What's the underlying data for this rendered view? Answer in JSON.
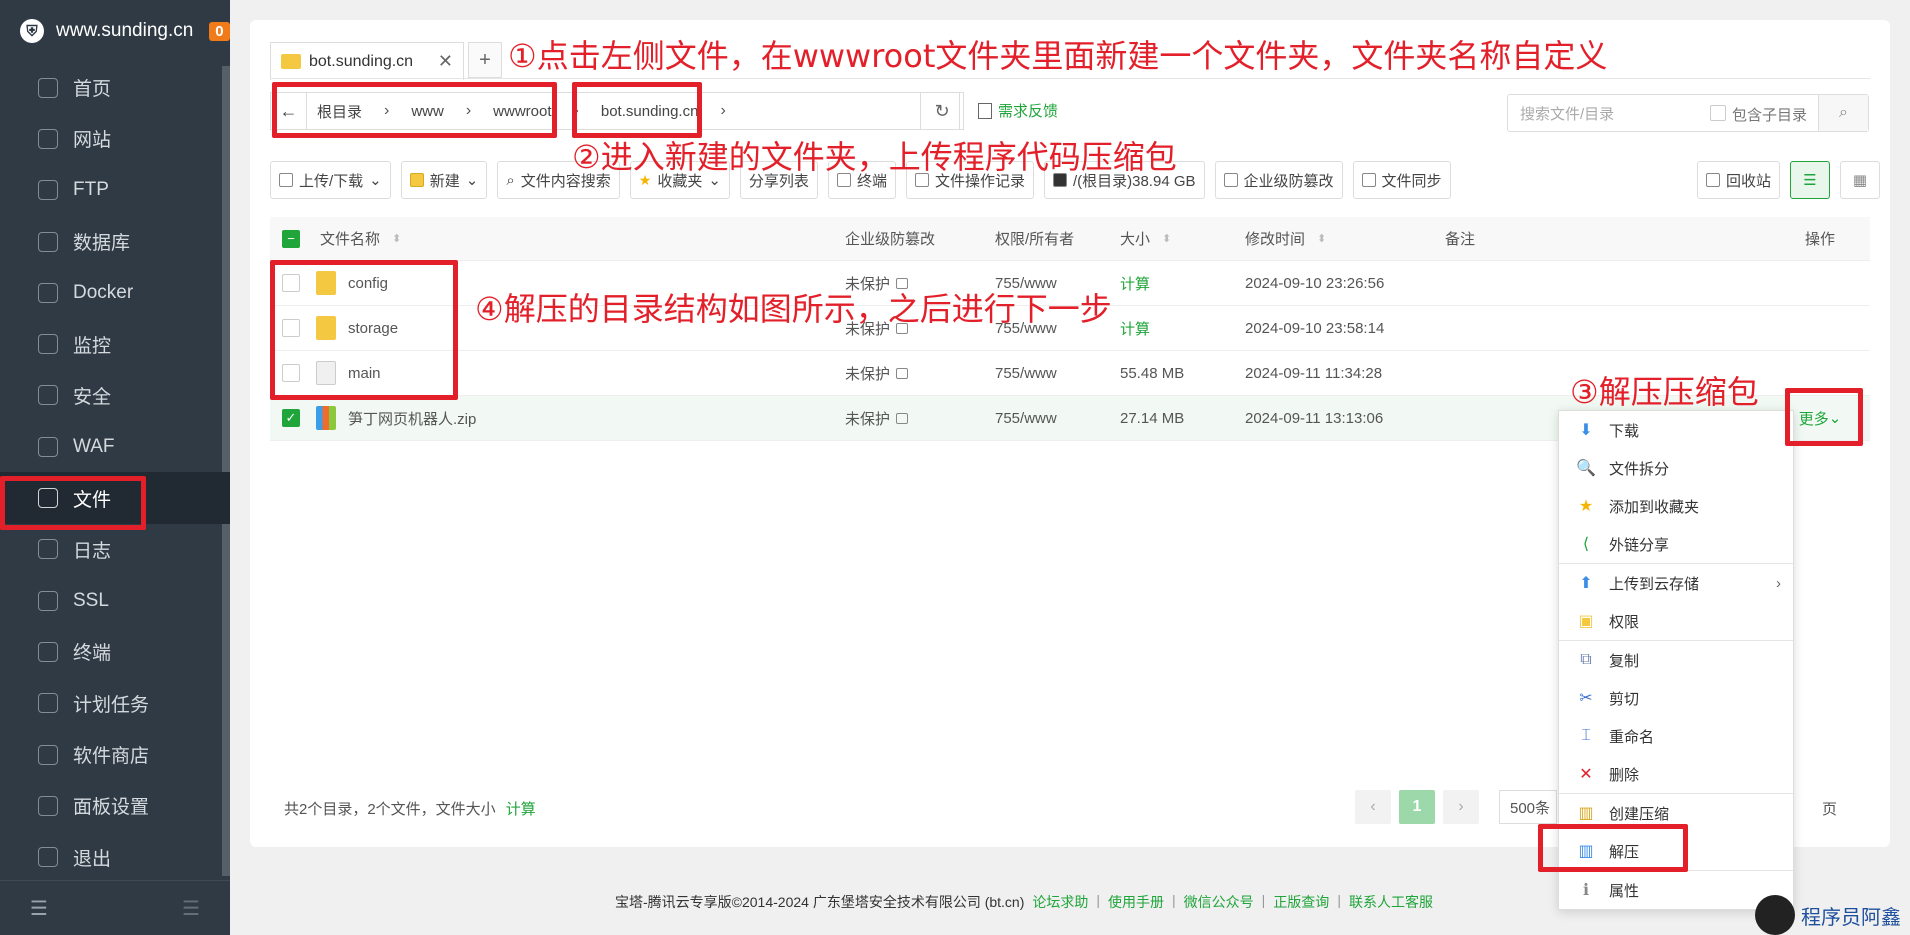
{
  "brand": {
    "site": "www.sunding.cn",
    "badge": "0"
  },
  "sidebar": {
    "items": [
      {
        "label": "首页",
        "name": "home"
      },
      {
        "label": "网站",
        "name": "website"
      },
      {
        "label": "FTP",
        "name": "ftp"
      },
      {
        "label": "数据库",
        "name": "database"
      },
      {
        "label": "Docker",
        "name": "docker"
      },
      {
        "label": "监控",
        "name": "monitor"
      },
      {
        "label": "安全",
        "name": "security"
      },
      {
        "label": "WAF",
        "name": "waf"
      },
      {
        "label": "文件",
        "name": "files"
      },
      {
        "label": "日志",
        "name": "logs"
      },
      {
        "label": "SSL",
        "name": "ssl"
      },
      {
        "label": "终端",
        "name": "terminal"
      },
      {
        "label": "计划任务",
        "name": "cron"
      },
      {
        "label": "软件商店",
        "name": "store"
      },
      {
        "label": "面板设置",
        "name": "settings"
      },
      {
        "label": "退出",
        "name": "logout"
      }
    ],
    "active": "文件"
  },
  "tab": {
    "label": "bot.sunding.cn",
    "close": "✕",
    "add": "+"
  },
  "path": {
    "back": "←",
    "segments": [
      "根目录",
      "www",
      "wwwroot",
      "bot.sunding.cn"
    ],
    "sep": "›",
    "refresh": "↻"
  },
  "feedback": "需求反馈",
  "search": {
    "placeholder": "搜索文件/目录",
    "sub_label": "包含子目录"
  },
  "toolbar": {
    "upload": "上传/下载",
    "new": "新建",
    "content_search": "文件内容搜索",
    "favorites": "收藏夹",
    "share_list": "分享列表",
    "terminal": "终端",
    "op_log": "文件操作记录",
    "disk": "/(根目录)38.94 GB",
    "tamper": "企业级防篡改",
    "sync": "文件同步",
    "recycle": "回收站"
  },
  "table": {
    "headers": {
      "name": "文件名称",
      "tamper": "企业级防篡改",
      "perm": "权限/所有者",
      "size": "大小",
      "mtime": "修改时间",
      "note": "备注",
      "ops": "操作"
    },
    "rows": [
      {
        "name": "config",
        "type": "folder",
        "tamper": "未保护",
        "perm": "755/www",
        "size": "计算",
        "mtime": "2024-09-10 23:26:56"
      },
      {
        "name": "storage",
        "type": "folder",
        "tamper": "未保护",
        "perm": "755/www",
        "size": "计算",
        "mtime": "2024-09-10 23:58:14"
      },
      {
        "name": "main",
        "type": "file",
        "tamper": "未保护",
        "perm": "755/www",
        "size": "55.48 MB",
        "mtime": "2024-09-11 11:34:28"
      },
      {
        "name": "笋丁网页机器人.zip",
        "type": "zip",
        "tamper": "未保护",
        "perm": "755/www",
        "size": "27.14 MB",
        "mtime": "2024-09-11 13:13:06"
      }
    ],
    "more": "更多"
  },
  "summary": {
    "text": "共2个目录，2个文件，文件大小",
    "calc": "计算"
  },
  "pager": {
    "prev": "‹",
    "page": "1",
    "next": "›",
    "size": "500条",
    "unit": "页"
  },
  "context_menu": [
    {
      "label": "下载",
      "icon": "download-icon"
    },
    {
      "label": "文件拆分",
      "icon": "split-icon"
    },
    {
      "label": "添加到收藏夹",
      "icon": "star-icon"
    },
    {
      "label": "外链分享",
      "icon": "share-icon"
    },
    {
      "label": "上传到云存储",
      "icon": "cloud-upload-icon"
    },
    {
      "label": "权限",
      "icon": "lock-icon"
    },
    {
      "label": "复制",
      "icon": "copy-icon"
    },
    {
      "label": "剪切",
      "icon": "scissors-icon"
    },
    {
      "label": "重命名",
      "icon": "rename-icon"
    },
    {
      "label": "删除",
      "icon": "delete-icon"
    },
    {
      "label": "创建压缩",
      "icon": "compress-icon"
    },
    {
      "label": "解压",
      "icon": "extract-icon"
    },
    {
      "label": "属性",
      "icon": "info-icon"
    }
  ],
  "footer": {
    "copyright": "宝塔-腾讯云专享版©2014-2024 广东堡塔安全技术有限公司 (bt.cn)",
    "links": [
      "论坛求助",
      "使用手册",
      "微信公众号",
      "正版查询",
      "联系人工客服"
    ]
  },
  "annotations": {
    "step1": "①点击左侧文件，在wwwroot文件夹里面新建一个文件夹，文件夹名称自定义",
    "step2": "②进入新建的文件夹，上传程序代码压缩包",
    "step3": "③解压压缩包",
    "step4": "④解压的目录结构如图所示，之后进行下一步"
  },
  "watermark": "程序员阿鑫",
  "colors": {
    "accent": "#20a53a",
    "sidebar": "#2f3a44",
    "annotation": "#e3202a"
  }
}
